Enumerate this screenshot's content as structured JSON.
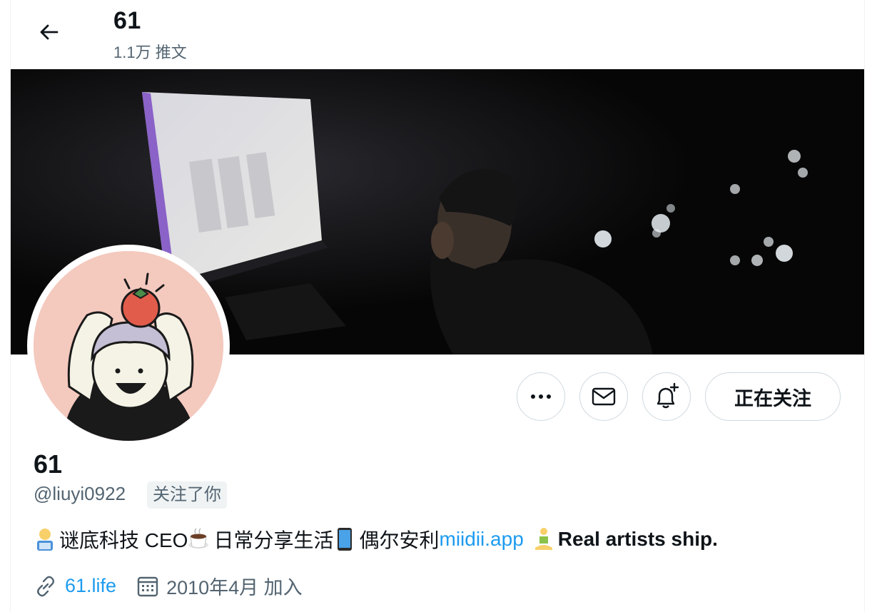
{
  "header": {
    "title": "61",
    "tweet_count": "1.1万 推文"
  },
  "profile": {
    "display_name": "61",
    "handle": "@liuyi0922",
    "follows_you_badge": "关注了你",
    "bio": {
      "part1": "谜底科技 CEO ",
      "part2": "日常分享生活 ",
      "part3": "偶尔安利",
      "link": "miidii.app",
      "part4": "Real artists ship."
    },
    "website": "61.life",
    "joined": "2010年4月 加入"
  },
  "actions": {
    "follow_label": "正在关注"
  },
  "colors": {
    "link": "#1d9bf0",
    "secondary_text": "#536471",
    "border": "#cfd9de"
  }
}
